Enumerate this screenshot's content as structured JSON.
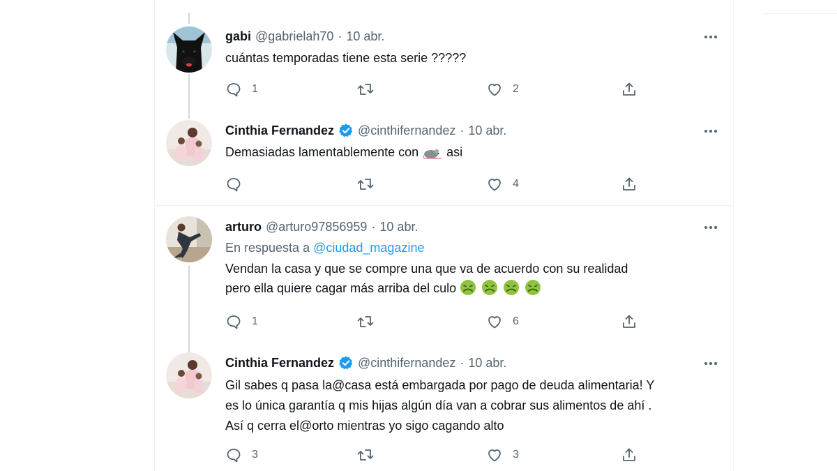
{
  "tweets": [
    {
      "name": "gabi",
      "handle": "@gabrielah70",
      "date": "10 abr.",
      "verified": false,
      "reply_to_prefix": "",
      "reply_to": "",
      "text": "cuántas temporadas tiene esta serie ?????",
      "replies": "1",
      "retweets": "",
      "likes": "2",
      "avatar_icon": "black-dog-avatar"
    },
    {
      "name": "Cinthia Fernandez",
      "handle": "@cinthifernandez",
      "date": "10 abr.",
      "verified": true,
      "text_before_emoji": "Demasiadas lamentablemente con ",
      "emoji": "rat-emoji",
      "text_after_emoji": " asi",
      "replies": "",
      "retweets": "",
      "likes": "4",
      "avatar_icon": "family-photo-avatar"
    },
    {
      "name": "arturo",
      "handle": "@arturo97856959",
      "date": "10 abr.",
      "verified": false,
      "reply_to_prefix": "En respuesta a",
      "reply_to": "@ciudad_magazine",
      "text": "Vendan la casa y que se compre una que va de acuerdo con su realidad\npero ella quiere cagar más arriba del culo",
      "emojis": [
        "nauseated-face-emoji",
        "nauseated-face-emoji",
        "nauseated-face-emoji",
        "nauseated-face-emoji"
      ],
      "replies": "1",
      "retweets": "",
      "likes": "6",
      "avatar_icon": "man-photo-avatar"
    },
    {
      "name": "Cinthia Fernandez",
      "handle": "@cinthifernandez",
      "date": "10 abr.",
      "verified": true,
      "text": "Gil sabes q pasa la@casa está embargada por pago de deuda alimentaria! Y\nes lo única garantía q mis hijas algún día van a cobrar sus alimentos de ahí .\nAsí q cerra el@orto mientras yo sigo cagando alto",
      "replies": "3",
      "retweets": "",
      "likes": "3",
      "avatar_icon": "family-photo-avatar"
    }
  ],
  "colors": {
    "text": "#0f1419",
    "secondary": "#536471",
    "link": "#1d9bf0",
    "verified": "#1d9bf0",
    "divider": "#eff3f4",
    "thread_line": "#cfd9de"
  },
  "icons": {
    "reply": "reply-icon",
    "retweet": "retweet-icon",
    "like": "like-icon",
    "share": "share-icon",
    "more": "more-icon",
    "verified": "verified-badge-icon"
  }
}
